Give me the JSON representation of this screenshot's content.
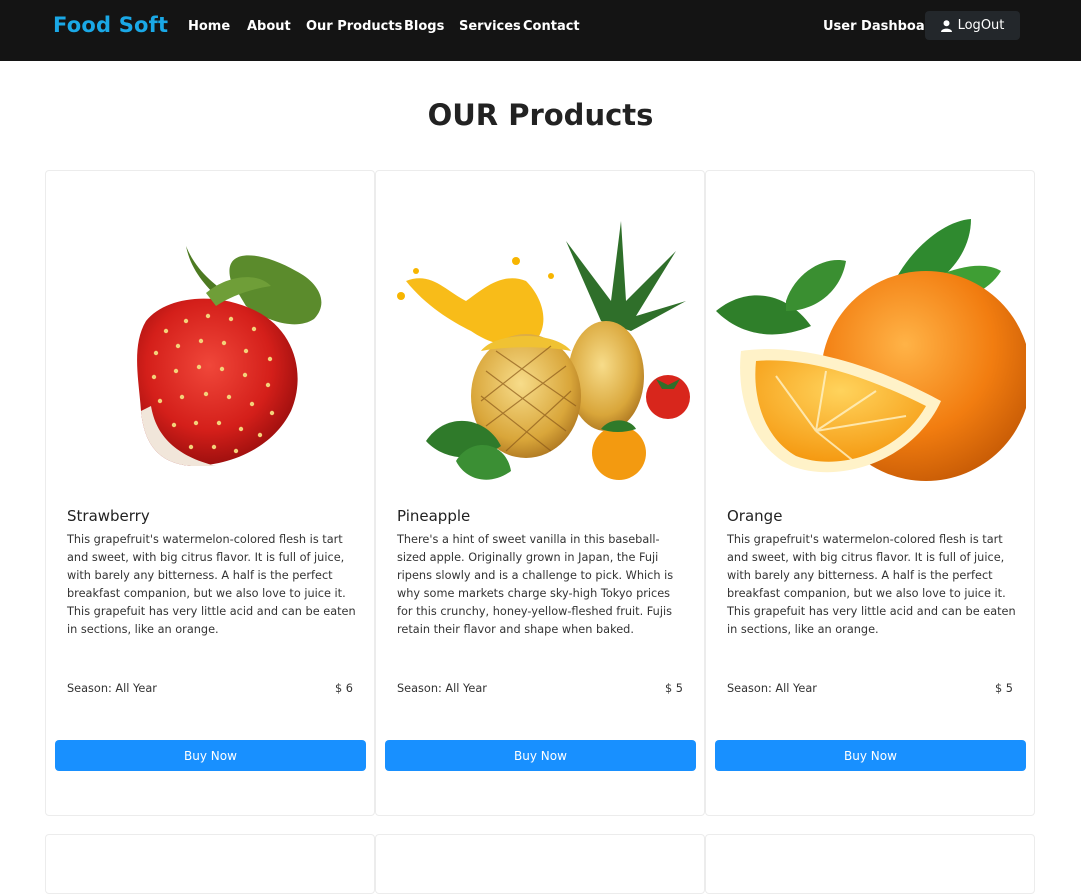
{
  "navbar": {
    "brand": "Food Soft",
    "links": [
      "Home",
      "About",
      "Our Products",
      "Blogs",
      "Services",
      "Contact"
    ],
    "user_dashboard": "User Dashboard",
    "logout_label": "LogOut"
  },
  "page": {
    "title": "OUR Products"
  },
  "products": [
    {
      "name": "Strawberry",
      "description": "This grapefruit's watermelon-colored flesh is tart and sweet, with big citrus flavor. It is full of juice, with barely any bitterness. A half is the perfect breakfast companion, but we also love to juice it. This grapefuit has very little acid and can be eaten in sections, like an orange.",
      "season": "Season: All Year",
      "price": "$ 6",
      "button": "Buy Now"
    },
    {
      "name": "Pineapple",
      "description": "There's a hint of sweet vanilla in this baseball-sized apple. Originally grown in Japan, the Fuji ripens slowly and is a challenge to pick. Which is why some markets charge sky-high Tokyo prices for this crunchy, honey-yellow-fleshed fruit. Fujis retain their flavor and shape when baked.",
      "season": "Season: All Year",
      "price": "$ 5",
      "button": "Buy Now"
    },
    {
      "name": "Orange",
      "description": "This grapefruit's watermelon-colored flesh is tart and sweet, with big citrus flavor. It is full of juice, with barely any bitterness. A half is the perfect breakfast companion, but we also love to juice it. This grapefuit has very little acid and can be eaten in sections, like an orange.",
      "season": "Season: All Year",
      "price": "$ 5",
      "button": "Buy Now"
    }
  ],
  "colors": {
    "navbar_bg": "#141414",
    "brand": "#1aa8e6",
    "button": "#1890ff"
  },
  "icons": {
    "logout": "user-icon"
  }
}
